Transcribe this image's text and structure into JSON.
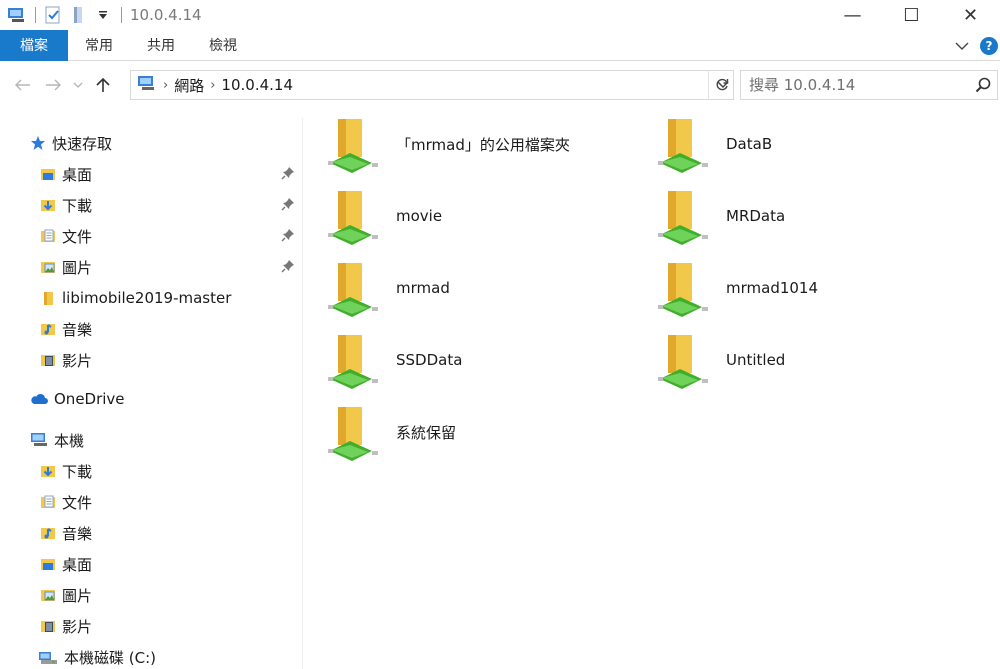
{
  "window": {
    "title": "10.0.4.14",
    "controls": {
      "minimize": "—",
      "maximize": "☐",
      "close": "✕"
    }
  },
  "ribbon": {
    "tabs": [
      "檔案",
      "常用",
      "共用",
      "檢視"
    ],
    "help": "?"
  },
  "address": {
    "breadcrumbs": [
      "網路",
      "10.0.4.14"
    ],
    "search_placeholder": "搜尋 10.0.4.14"
  },
  "nav": {
    "quick_access": "快速存取",
    "quick_items": [
      {
        "label": "桌面",
        "icon": "desktop-folder-icon",
        "pinned": true
      },
      {
        "label": "下載",
        "icon": "downloads-folder-icon",
        "pinned": true
      },
      {
        "label": "文件",
        "icon": "documents-folder-icon",
        "pinned": true
      },
      {
        "label": "圖片",
        "icon": "pictures-folder-icon",
        "pinned": true
      },
      {
        "label": "libimobile2019-master",
        "icon": "folder-icon",
        "pinned": false
      },
      {
        "label": "音樂",
        "icon": "music-folder-icon",
        "pinned": false
      },
      {
        "label": "影片",
        "icon": "videos-folder-icon",
        "pinned": false
      }
    ],
    "onedrive": "OneDrive",
    "this_pc": "本機",
    "pc_items": [
      {
        "label": "下載",
        "icon": "downloads-folder-icon"
      },
      {
        "label": "文件",
        "icon": "documents-folder-icon"
      },
      {
        "label": "音樂",
        "icon": "music-folder-icon"
      },
      {
        "label": "桌面",
        "icon": "desktop-folder-icon"
      },
      {
        "label": "圖片",
        "icon": "pictures-folder-icon"
      },
      {
        "label": "影片",
        "icon": "videos-folder-icon"
      },
      {
        "label": "本機磁碟 (C:)",
        "icon": "drive-icon"
      }
    ]
  },
  "shares": [
    "「mrmad」的公用檔案夾",
    "DataB",
    "movie",
    "MRData",
    "mrmad",
    "mrmad1014",
    "SSDData",
    "Untitled",
    "系統保留"
  ],
  "colors": {
    "accent": "#1979ca",
    "folder": "#f2c84b",
    "network": "#3fae2a"
  }
}
